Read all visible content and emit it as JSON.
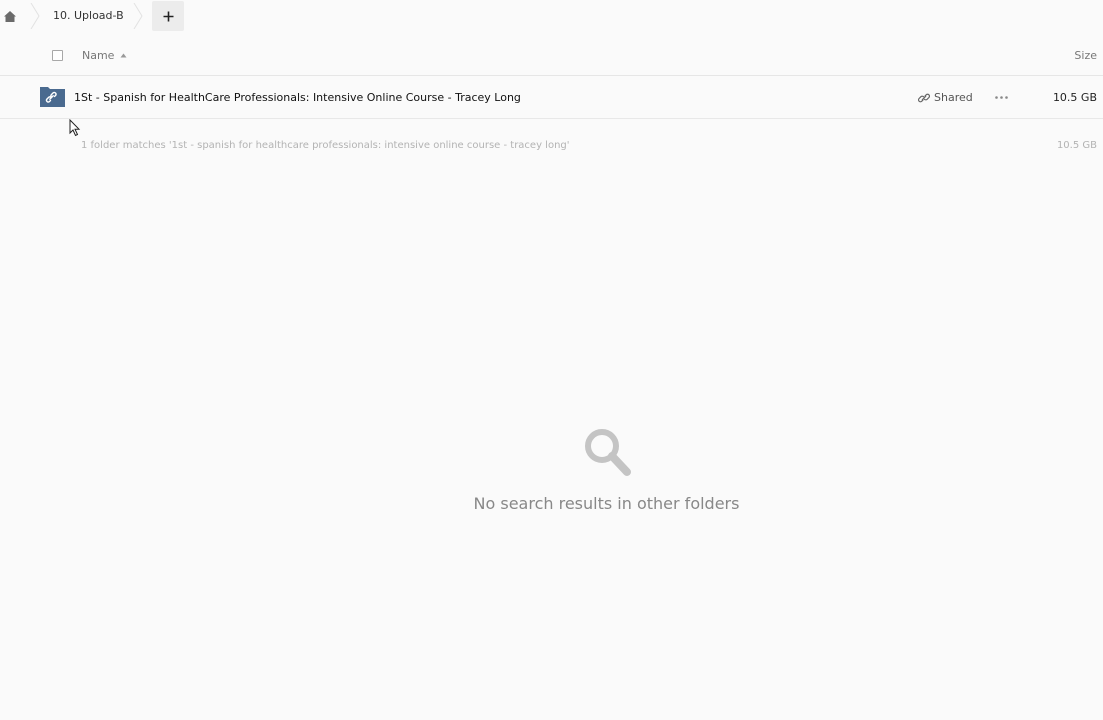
{
  "breadcrumb": {
    "home_icon": "home-icon",
    "current": "10. Upload-B",
    "new_icon": "plus-icon"
  },
  "table": {
    "header": {
      "name": "Name",
      "size": "Size",
      "sort": "ascending"
    },
    "rows": [
      {
        "name": "1St - Spanish for HealthCare Professionals: Intensive Online Course - Tracey Long",
        "icon": "shared-folder-icon",
        "shared_label": "Shared",
        "size": "10.5 GB"
      }
    ],
    "summary": "1 folder matches '1st - spanish for healthcare professionals: intensive online course - tracey long'",
    "summary_size": "10.5 GB"
  },
  "empty_state": {
    "icon": "search-icon",
    "message": "No search results in other folders"
  },
  "colors": {
    "background": "#fafafa",
    "folder": "#4a6a8f",
    "muted_text": "#b3b3b3"
  }
}
